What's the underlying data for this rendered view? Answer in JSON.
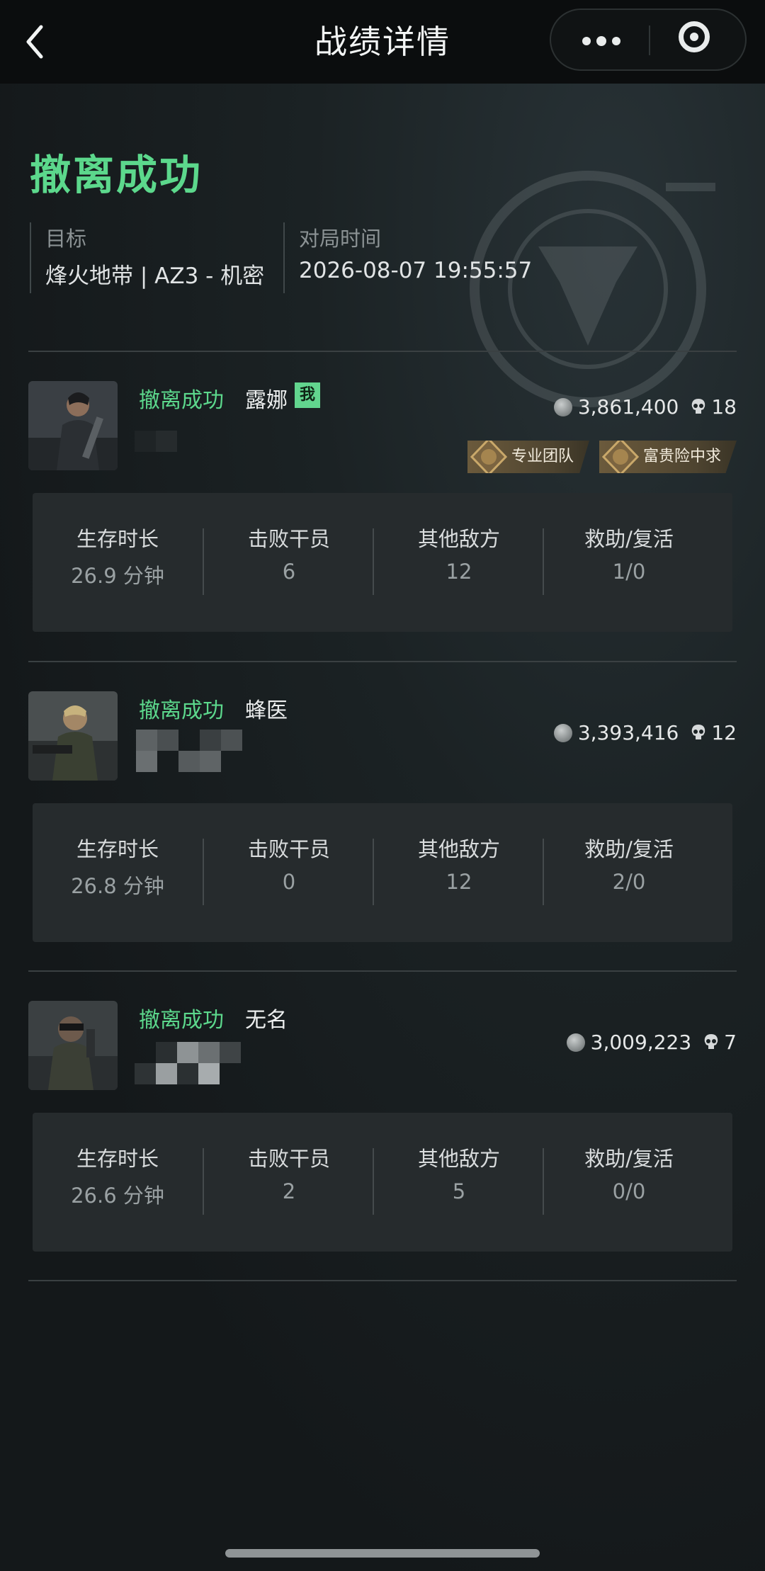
{
  "nav": {
    "title": "战绩详情"
  },
  "header": {
    "result": "撤离成功",
    "target_label": "目标",
    "target_value": "烽火地带 | AZ3 - 机密",
    "time_label": "对局时间",
    "time_value": "2026-08-07 19:55:57"
  },
  "stat_labels": [
    "生存时长",
    "击败干员",
    "其他敌方",
    "救助/复活"
  ],
  "players": [
    {
      "status": "撤离成功",
      "name": "露娜",
      "me_badge": "我",
      "money": "3,861,400",
      "kills": "18",
      "tags": [
        "专业团队",
        "富贵险中求"
      ],
      "stats": [
        "26.9 分钟",
        "6",
        "12",
        "1/0"
      ]
    },
    {
      "status": "撤离成功",
      "name": "蜂医",
      "money": "3,393,416",
      "kills": "12",
      "stats": [
        "26.8 分钟",
        "0",
        "12",
        "2/0"
      ]
    },
    {
      "status": "撤离成功",
      "name": "无名",
      "money": "3,009,223",
      "kills": "7",
      "stats": [
        "26.6 分钟",
        "2",
        "5",
        "0/0"
      ]
    }
  ],
  "icons": {
    "back": "chevron-left-icon",
    "more": "more-dots-icon",
    "close": "target-close-icon",
    "money": "coin-icon",
    "kills": "skull-icon",
    "tag": "medal-icon"
  },
  "colors": {
    "accent_green": "#5cd88c",
    "background": "#161a1b",
    "stats_panel": "#262b2d"
  }
}
